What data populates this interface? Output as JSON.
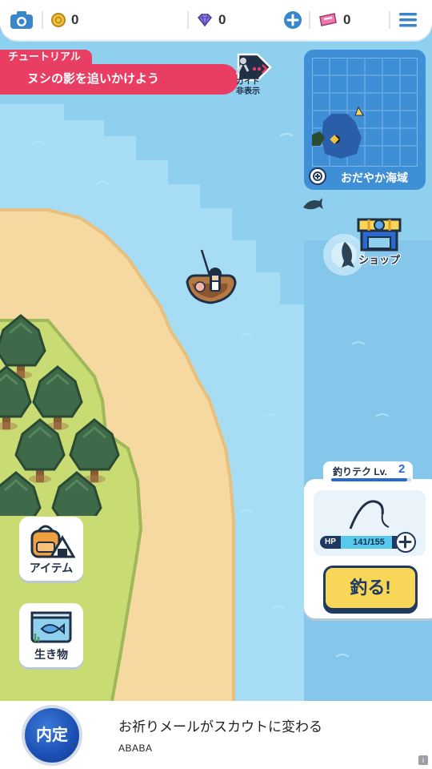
{
  "topbar": {
    "coins": "0",
    "gems": "0",
    "tickets": "0"
  },
  "tutorial": {
    "tag": "チュートリアル",
    "mission": "ヌシの影を追いかけよう",
    "guide_line1": "ガイド",
    "guide_line2": "非表示"
  },
  "minimap": {
    "area_name": "おだやか海域"
  },
  "shop": {
    "label": "ショップ"
  },
  "side_buttons": {
    "items_label": "アイテム",
    "creatures_label": "生き物"
  },
  "fishing": {
    "skill_label": "釣りテク Lv.",
    "skill_level": "2",
    "skill_progress": 0.95,
    "hp_tag": "HP",
    "hp_text": "141/155",
    "hp_current": 141,
    "hp_max": 155,
    "fish_button": "釣る!"
  },
  "ad": {
    "logo_text": "内定",
    "title": "お祈りメールがスカウトに変わる",
    "subtitle": "ABABA",
    "info": "i"
  },
  "colors": {
    "ocean": "#8fd0ef",
    "deep_ocean": "#a8dcf3",
    "sand": "#f6d9a0",
    "grass": "#c9dc74",
    "banner": "#e93e63",
    "fish_button": "#f8d657",
    "navy": "#1f3a60"
  }
}
